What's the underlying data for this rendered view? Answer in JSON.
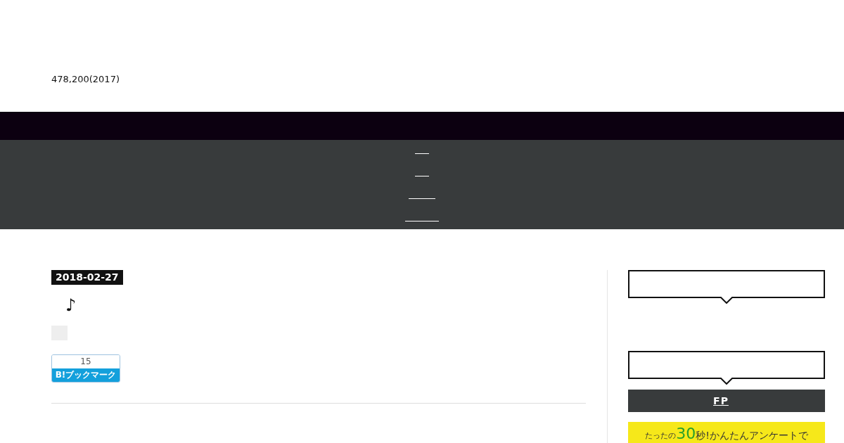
{
  "header": {
    "tagline": "478,200(2017)"
  },
  "post": {
    "date": "2018-02-27",
    "title": "♪",
    "hatena": {
      "count": "15",
      "label": "B!ブックマーク"
    }
  },
  "sidebar": {
    "headings": [
      {
        "kind": "box"
      },
      {
        "kind": "box"
      }
    ],
    "button": "FP",
    "banner": {
      "lead": "たったの",
      "number": "30",
      "tail": "秒!かんたんアンケートで"
    }
  }
}
